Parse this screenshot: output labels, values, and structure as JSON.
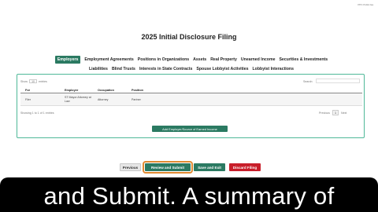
{
  "header": {
    "corner_text": "PPC Public Ea",
    "page_title": "2025 Initial Disclosure Filing"
  },
  "tabs_row1": [
    {
      "label": "Employers",
      "active": true
    },
    {
      "label": "Employment Agreements",
      "active": false
    },
    {
      "label": "Positions in Organizations",
      "active": false
    },
    {
      "label": "Assets",
      "active": false
    },
    {
      "label": "Real Property",
      "active": false
    },
    {
      "label": "Unearned Income",
      "active": false
    },
    {
      "label": "Securities & Investments",
      "active": false
    }
  ],
  "tabs_row2": [
    {
      "label": "Liabilities"
    },
    {
      "label": "Blind Trusts"
    },
    {
      "label": "Interests in State Contracts"
    },
    {
      "label": "Spouse Lobbyist Activities"
    },
    {
      "label": "Lobbyist Interactions"
    }
  ],
  "table_controls": {
    "show_label": "Show",
    "show_value": "10",
    "entries_label": "entries",
    "search_label": "Search:"
  },
  "table": {
    "columns": [
      "For",
      "Employer",
      "Occupation",
      "Position"
    ],
    "rows": [
      {
        "for": "Filer",
        "employer": "ST Mayor Attorney at Law",
        "occupation": "Attorney",
        "position": "Partner"
      }
    ],
    "showing_text": "Showing 1 to 1 of 1 entries",
    "pager": {
      "previous": "Previous",
      "page": "1",
      "next": "Next"
    }
  },
  "add_button_label": "Add Employer/Source of Earned Income",
  "actions": {
    "previous": "Previous",
    "review_submit": "Review and Submit",
    "save_exit": "Save and Exit",
    "discard": "Discard Filing"
  },
  "caption": "and Submit. A summary of",
  "colors": {
    "accent": "#2b7a62",
    "panel_border": "#4fb898",
    "discard": "#c81e2a",
    "highlight": "#e08a32"
  }
}
